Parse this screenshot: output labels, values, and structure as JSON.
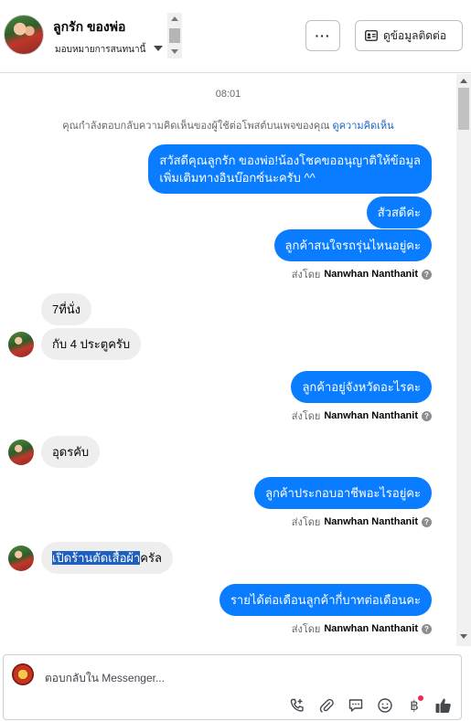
{
  "header": {
    "contact_name": "ลูกรัก ของพ่อ",
    "assign_label": "มอบหมายการสนทนานี้",
    "more_label": "···",
    "view_contact_label": "ดูข้อมูลติดต่อ"
  },
  "chat": {
    "timestamp": "08:01",
    "notice_text": "คุณกำลังตอบกลับความคิดเห็นของผู้ใช้ต่อโพสต์บนเพจของคุณ",
    "notice_link": "ดูความคิดเห็น",
    "sent_by_prefix": "ส่งโดย",
    "sender_name": "Nanwhan Nanthanit",
    "messages": [
      {
        "dir": "out",
        "text_line1": "สวัสดีคุณลูกรัก ของพ่อ!น้องโชคขออนุญาติให้ข้อมูล",
        "text_line2": "เพิ่มเติมทางอินบ๊อกซ์นะครับ ^^"
      },
      {
        "dir": "out",
        "text": "สัวสดีค่ะ"
      },
      {
        "dir": "out",
        "text": "ลูกค้าสนใจรถรุ่นไหนอยู่คะ"
      },
      {
        "dir": "in",
        "text": "7ที่นั่ง"
      },
      {
        "dir": "in",
        "text": "กับ 4 ประตูครับ"
      },
      {
        "dir": "out",
        "text": "ลูกค้าอยู่จังหวัดอะไรคะ"
      },
      {
        "dir": "in",
        "text": "อุดรคับ"
      },
      {
        "dir": "out",
        "text": "ลูกค้าประกอบอาชีพอะไรอยู่คะ"
      },
      {
        "dir": "in",
        "text_highlight": "เปิดร้านตัดเสื้อผ้า",
        "text_rest": "ครัล"
      },
      {
        "dir": "out",
        "text": "รายได้ต่อเดือนลูกค้ากี่บาทต่อเดือนคะ"
      }
    ]
  },
  "composer": {
    "placeholder": "ตอบกลับใน Messenger...",
    "currency_symbol": "฿"
  },
  "icons": {
    "more": "more-horizontal-icon",
    "contact_card": "contact-card-icon",
    "help": "question-icon",
    "call": "phone-plus-icon",
    "attach": "paperclip-icon",
    "saved_reply": "chat-bubble-icon",
    "emoji": "smiley-icon",
    "payment": "baht-icon",
    "like": "thumbs-up-icon"
  },
  "colors": {
    "outgoing_bubble": "#0a7cff",
    "incoming_bubble": "#eeeeee",
    "link": "#1a66c9",
    "notification_dot": "#f02849"
  }
}
